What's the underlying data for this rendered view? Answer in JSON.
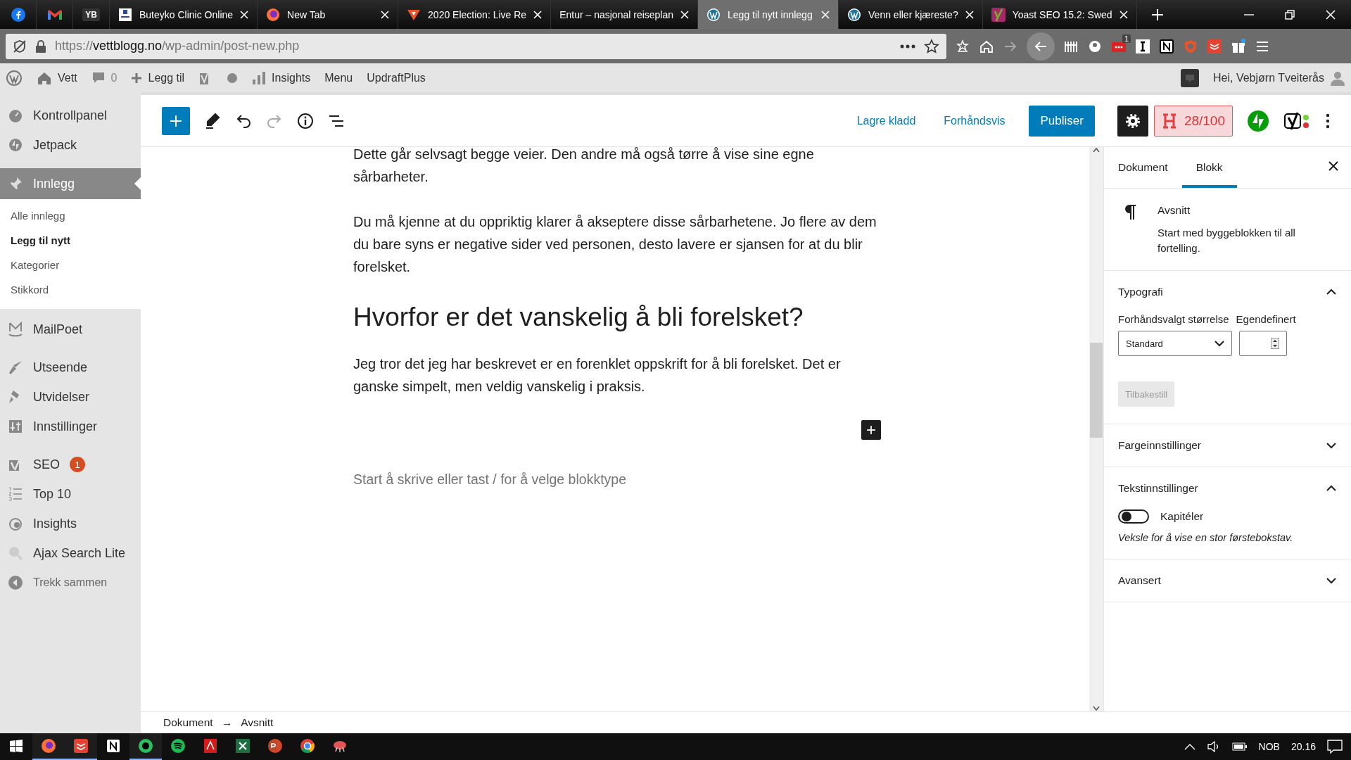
{
  "browser": {
    "tabs": [
      {
        "kind": "pinned",
        "selected": false
      },
      {
        "kind": "pinned",
        "selected": false
      },
      {
        "kind": "pinned",
        "label": "YB",
        "selected": false
      },
      {
        "kind": "normal",
        "title": "Buteyko Clinic Online",
        "selected": false
      },
      {
        "kind": "normal",
        "title": "New Tab",
        "selected": false
      },
      {
        "kind": "normal",
        "title": "2020 Election: Live Re",
        "selected": false
      },
      {
        "kind": "normal",
        "title": "Entur – nasjonal reiseplan",
        "selected": false
      },
      {
        "kind": "normal",
        "title": "Legg til nytt innlegg",
        "selected": true
      },
      {
        "kind": "normal",
        "title": "Venn eller kjæreste?",
        "selected": false
      },
      {
        "kind": "normal",
        "title": "Yoast SEO 15.2: Swed",
        "selected": false
      }
    ],
    "url": {
      "scheme": "https://",
      "domain": "vettblogg.no",
      "path": "/wp-admin/post-new.php"
    },
    "extension_badge": "1"
  },
  "admin_bar": {
    "site": "Vett",
    "comments": "0",
    "new": "Legg til",
    "insights": "Insights",
    "menu": "Menu",
    "updraft": "UpdraftPlus",
    "greeting": "Hei, Vebjørn Tveiterås"
  },
  "sidebar": {
    "items": [
      {
        "label": "Kontrollpanel",
        "selected": false
      },
      {
        "label": "Jetpack",
        "selected": false
      },
      {
        "label": "Innlegg",
        "selected": true,
        "children": [
          {
            "label": "Alle innlegg",
            "selected": false
          },
          {
            "label": "Legg til nytt",
            "selected": true
          },
          {
            "label": "Kategorier",
            "selected": false
          },
          {
            "label": "Stikkord",
            "selected": false
          }
        ]
      },
      {
        "label": "MailPoet",
        "selected": false
      },
      {
        "label": "Utseende",
        "selected": false
      },
      {
        "label": "Utvidelser",
        "selected": false
      },
      {
        "label": "Innstillinger",
        "selected": false
      },
      {
        "label": "SEO",
        "selected": false,
        "badge": "1"
      },
      {
        "label": "Top 10",
        "selected": false
      },
      {
        "label": "Insights",
        "selected": false
      },
      {
        "label": "Ajax Search Lite",
        "selected": false
      }
    ],
    "collapse": "Trekk sammen"
  },
  "editor_header": {
    "save_draft": "Lagre kladd",
    "preview": "Forhåndsvis",
    "publish": "Publiser",
    "settings_open": true,
    "seo_score": "28/100"
  },
  "content": {
    "blocks": [
      {
        "kind": "paragraph",
        "text": "Dette går selvsagt begge veier. Den andre må også tørre å vise sine egne sårbarheter."
      },
      {
        "kind": "paragraph",
        "text": "Du må kjenne at du oppriktig klarer å akseptere disse sårbarhetene. Jo flere av dem du bare syns er negative sider ved personen, desto lavere er sjansen for at du blir forelsket."
      },
      {
        "kind": "heading",
        "text": "Hvorfor er det vanskelig å bli forelsket?"
      },
      {
        "kind": "paragraph",
        "text": "Jeg tror det jeg har beskrevet er en forenklet oppskrift for å bli forelsket. Det er ganske simpelt, men veldig vanskelig i praksis."
      },
      {
        "kind": "inserter",
        "text": "+"
      },
      {
        "kind": "placeholder",
        "text": "Start å skrive eller tast / for å velge blokktype"
      }
    ]
  },
  "settings_panel": {
    "tabs": [
      {
        "label": "Dokument",
        "selected": false
      },
      {
        "label": "Blokk",
        "selected": true
      }
    ],
    "block": {
      "name": "Avsnitt",
      "description": "Start med byggeblokken til all fortelling."
    },
    "sections": [
      {
        "kind": "typography",
        "title": "Typografi",
        "expanded": true,
        "preset_label": "Forhåndsvalgt størrelse",
        "preset_value": "Standard",
        "custom_label": "Egendefinert",
        "reset": "Tilbakestill",
        "reset_disabled": true
      },
      {
        "kind": "plain",
        "title": "Fargeinnstillinger",
        "expanded": false
      },
      {
        "kind": "text_settings",
        "title": "Tekstinnstillinger",
        "expanded": true,
        "toggle_label": "Kapitéler",
        "on": false,
        "help": "Veksle for å vise en stor førstebokstav."
      },
      {
        "kind": "plain",
        "title": "Avansert",
        "expanded": false
      }
    ]
  },
  "breadcrumb": [
    "Dokument",
    "→",
    "Avsnitt"
  ],
  "taskbar": {
    "apps": [
      {
        "running": true
      },
      {
        "running": true
      },
      {
        "running": false
      },
      {
        "running": true
      },
      {
        "running": false
      },
      {
        "running": false
      },
      {
        "running": false
      },
      {
        "running": false
      },
      {
        "running": false
      },
      {
        "running": false
      }
    ],
    "language": "NOB",
    "time": "20.16"
  }
}
